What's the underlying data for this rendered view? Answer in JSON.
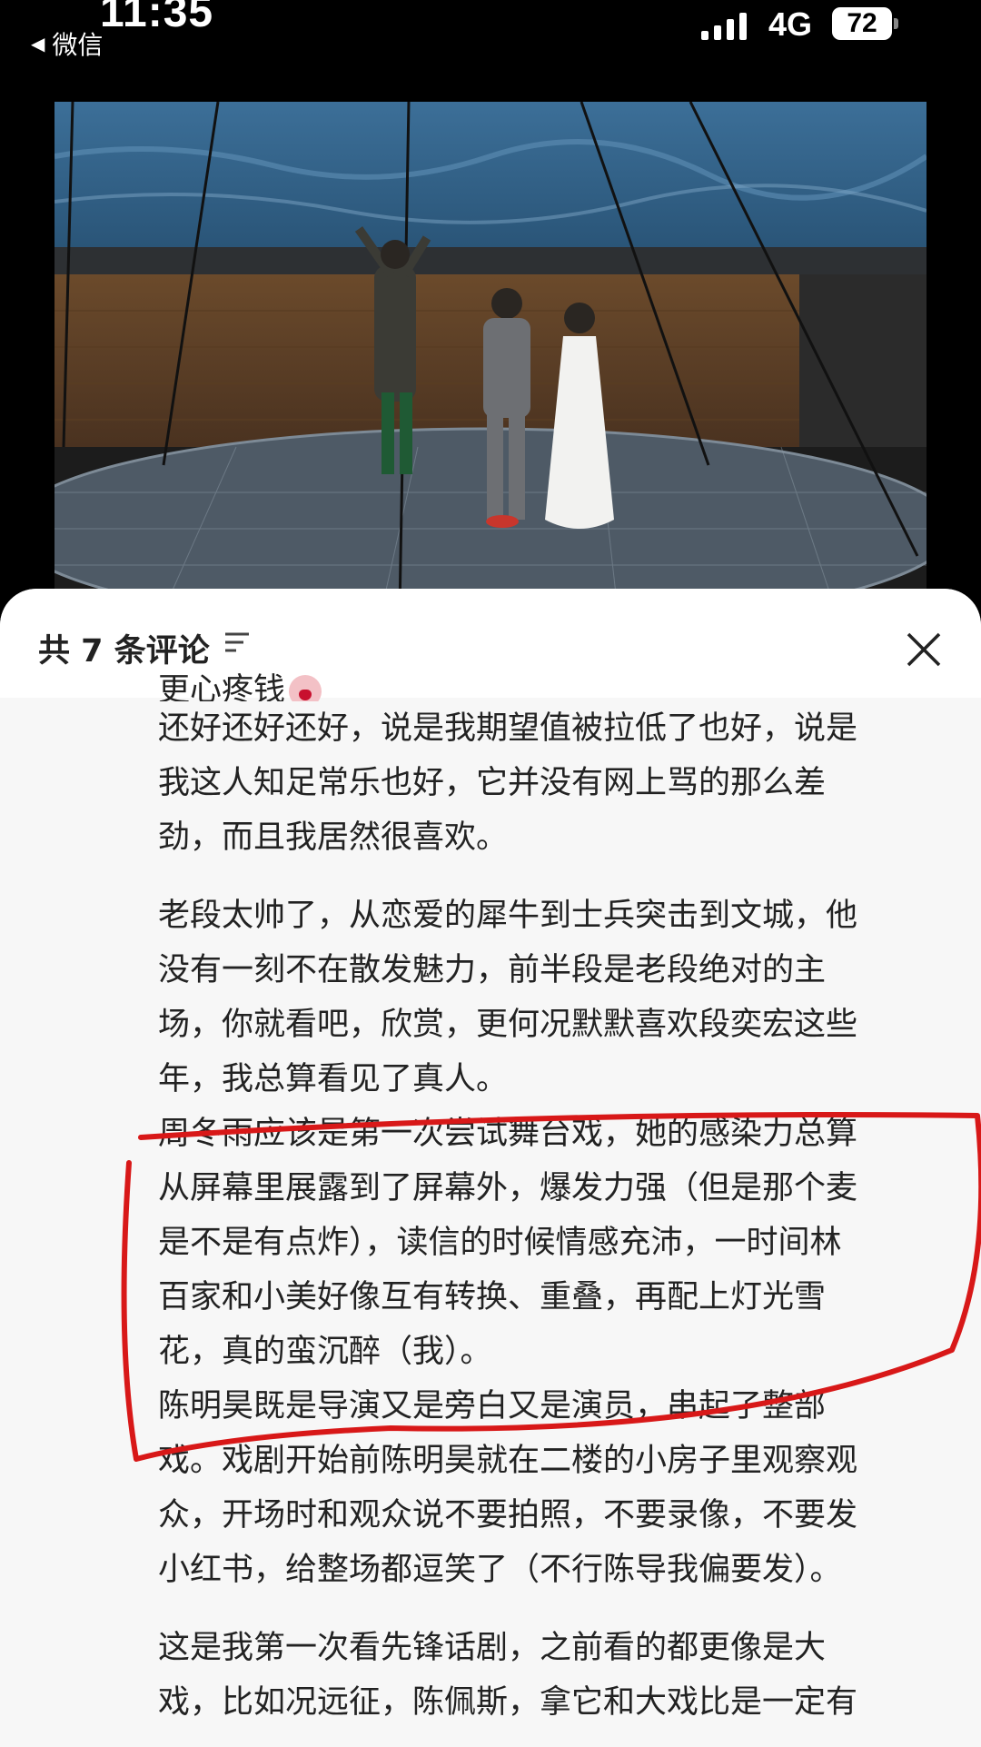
{
  "status_bar": {
    "time": "11:35",
    "back_label": "微信",
    "network": "4G",
    "battery": "72"
  },
  "stage_photo": {
    "subject": "stage performance photo"
  },
  "comments_sheet": {
    "title": "共 7 条评论",
    "paragraphs": {
      "p0": "更心疼钱",
      "p1_l1": "还好还好还好，说是我期望值被拉低了也好，说是",
      "p1_l2": "我这人知足常乐也好，它并没有网上骂的那么差",
      "p1_l3": "劲，而且我居然很喜欢。",
      "p2_l1": "老段太帅了，从恋爱的犀牛到士兵突击到文城，他",
      "p2_l2": "没有一刻不在散发魅力，前半段是老段绝对的主",
      "p2_l3": "场，你就看吧，欣赏，更何况默默喜欢段奕宏这些",
      "p2_l4": "年，我总算看见了真人。",
      "p3_l1": "周冬雨应该是第一次尝试舞台戏，她的感染力总算",
      "p3_l2": "从屏幕里展露到了屏幕外，爆发力强（但是那个麦",
      "p3_l3": "是不是有点炸），读信的时候情感充沛，一时间林",
      "p3_l4": "百家和小美好像互有转换、重叠，再配上灯光雪",
      "p3_l5": "花，真的蛮沉醉（我）。",
      "p4_l1": "陈明昊既是导演又是旁白又是演员，串起了整部",
      "p4_l2": "戏。戏剧开始前陈明昊就在二楼的小房子里观察观",
      "p4_l3": "众，开场时和观众说不要拍照，不要录像，不要发",
      "p4_l4": "小红书，给整场都逗笑了（不行陈导我偏要发）。",
      "p5_l1": "这是我第一次看先锋话剧，之前看的都更像是大",
      "p5_l2": "戏，比如况远征，陈佩斯，拿它和大戏比是一定有"
    }
  },
  "colors": {
    "accent_red": "#d81818",
    "sheet_bg": "#f7f7f7",
    "text": "#222222"
  }
}
